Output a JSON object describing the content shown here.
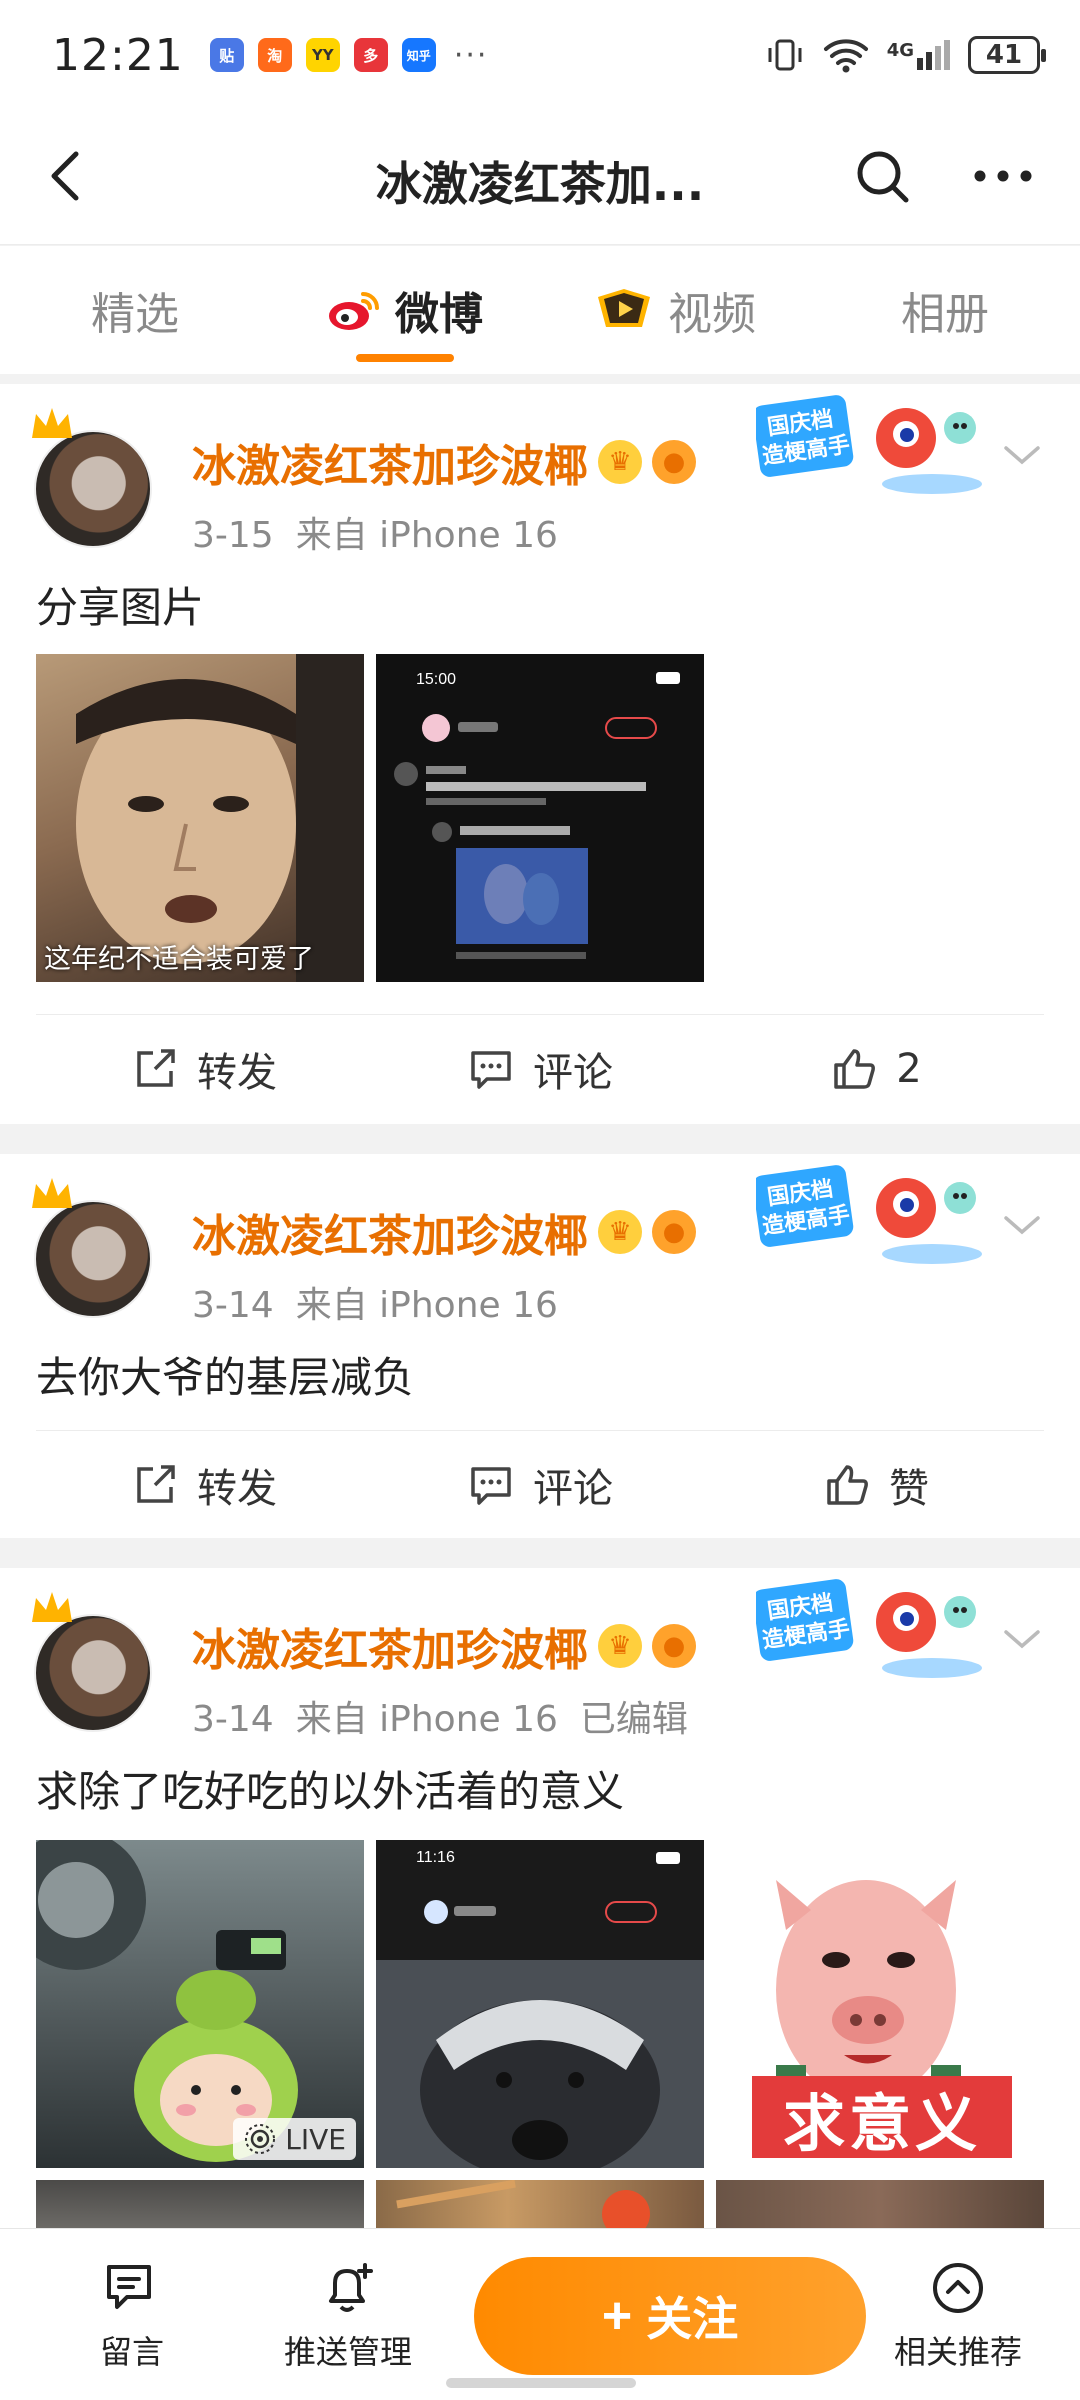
{
  "status_bar": {
    "time": "12:21",
    "notification_icons": [
      {
        "name": "tieba-app-icon",
        "label": "贴",
        "color": "#4a78e6"
      },
      {
        "name": "taobao-app-icon",
        "label": "淘",
        "color": "#ff6a1a"
      },
      {
        "name": "yy-app-icon",
        "label": "YY",
        "color": "#ffd400"
      },
      {
        "name": "pinduoduo-app-icon",
        "label": "多",
        "color": "#e8353a"
      },
      {
        "name": "zhihu-app-icon",
        "label": "知乎",
        "color": "#1677ff"
      }
    ],
    "more_indicator": "···",
    "network": "4G",
    "battery": "41"
  },
  "navbar": {
    "title": "冰激凌红茶加...",
    "back_icon": "chevron-left-icon",
    "search_icon": "search-icon",
    "more_icon": "more-icon"
  },
  "tabs": [
    {
      "label": "精选",
      "active": false
    },
    {
      "label": "微博",
      "active": true,
      "icon": "weibo-logo-icon"
    },
    {
      "label": "视频",
      "active": false,
      "icon": "video-icon"
    },
    {
      "label": "相册",
      "active": false
    }
  ],
  "posts": [
    {
      "username": "冰激凌红茶加珍波椰",
      "date": "3-15",
      "source": "来自 iPhone 16",
      "edited": "",
      "sticker": "国庆档 造梗高手",
      "text": "分享图片",
      "images": [
        {
          "kind": "photo-man",
          "caption": "这年纪不适合装可爱了"
        },
        {
          "kind": "screenshot-dark",
          "caption": ""
        }
      ],
      "repost_label": "转发",
      "comment_label": "评论",
      "like_label": "2"
    },
    {
      "username": "冰激凌红茶加珍波椰",
      "date": "3-14",
      "source": "来自 iPhone 16",
      "edited": "",
      "sticker": "国庆档 造梗高手",
      "text": "去你大爷的基层减负",
      "images": [],
      "repost_label": "转发",
      "comment_label": "评论",
      "like_label": "赞"
    },
    {
      "username": "冰激凌红茶加珍波椰",
      "date": "3-14",
      "source": "来自 iPhone 16",
      "edited": "已编辑",
      "sticker": "国庆档 造梗高手",
      "text": "求除了吃好吃的以外活着的意义",
      "images": [
        {
          "kind": "green-toy",
          "caption": "LIVE"
        },
        {
          "kind": "badger-screenshot",
          "caption": ""
        },
        {
          "kind": "pig-meme",
          "caption": "求意义"
        }
      ]
    }
  ],
  "bottom_bar": {
    "message_label": "留言",
    "push_label": "推送管理",
    "follow_label": "关注",
    "related_label": "相关推荐"
  },
  "colors": {
    "accent": "#ff8200",
    "username": "#e86f00",
    "follow_button": "#ff9214"
  }
}
